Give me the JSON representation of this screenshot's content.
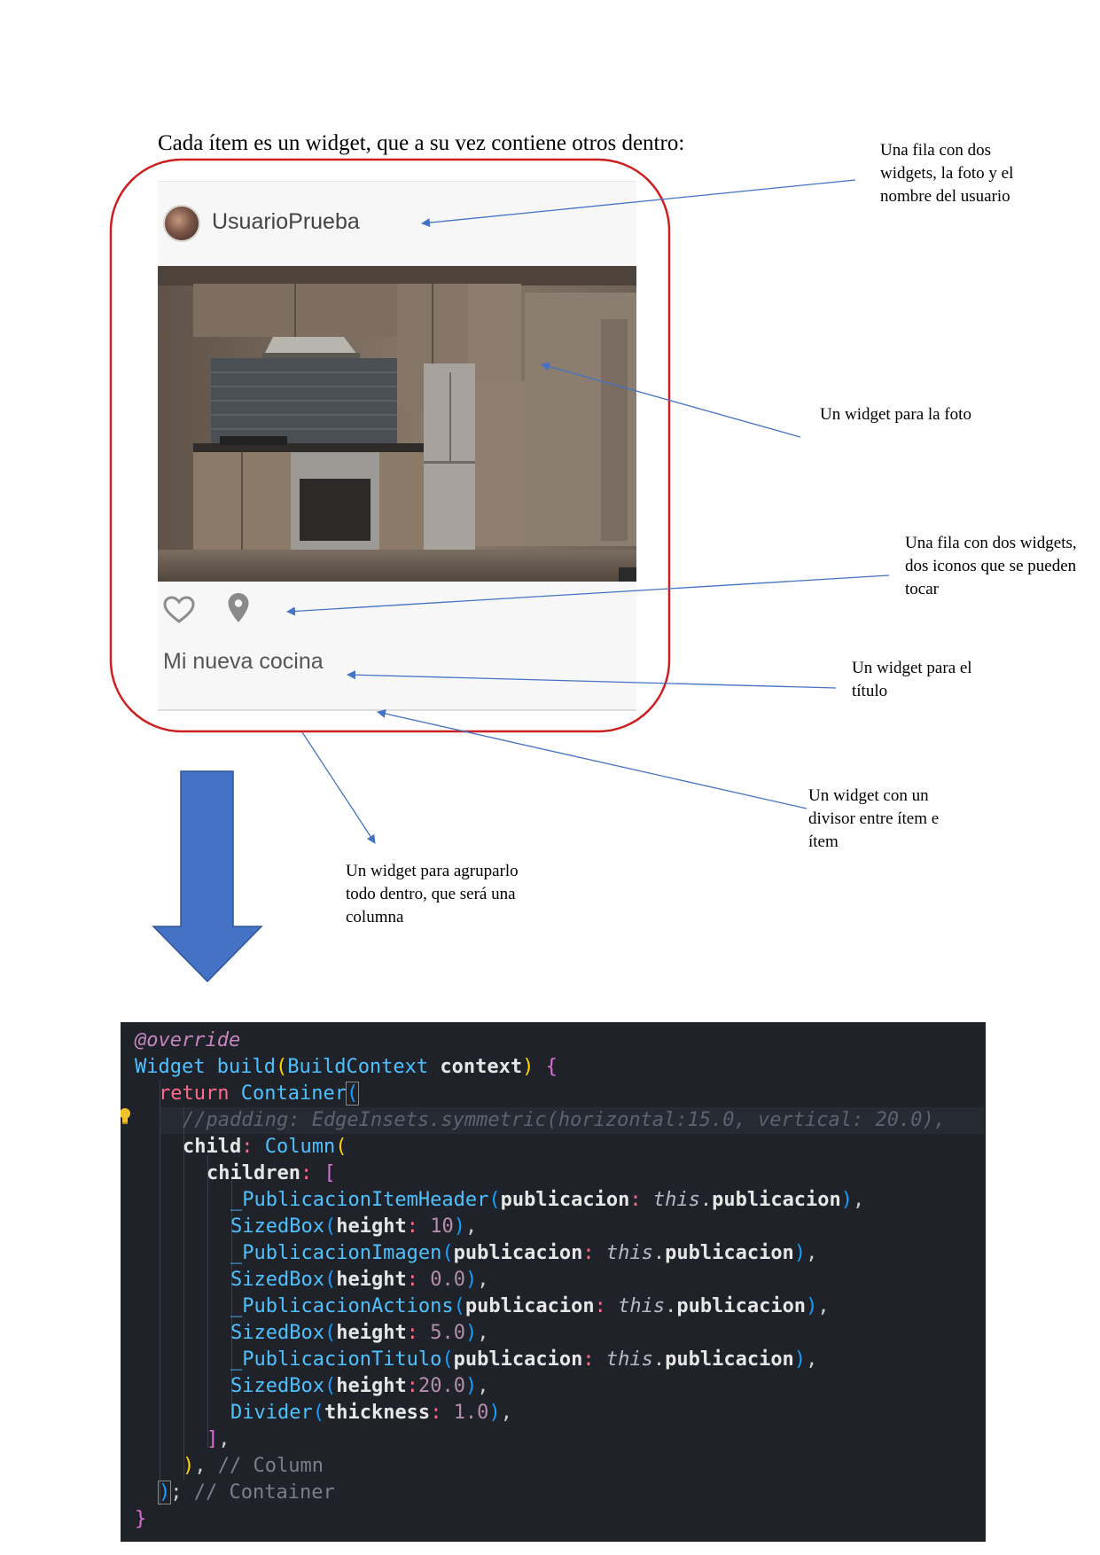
{
  "heading": "Cada ítem es un widget, que a su vez contiene otros dentro:",
  "card": {
    "username": "UsuarioPrueba",
    "title": "Mi nueva cocina",
    "icons": [
      "avatar-photo",
      "heart-outline-icon",
      "location-pin-icon"
    ]
  },
  "notes": {
    "header_row": "Una fila con dos widgets, la foto y el nombre del usuario",
    "photo": "Un widget para la foto",
    "actions_row": "Una fila con dos widgets, dos iconos que se pueden tocar",
    "title": "Un widget para el título",
    "divider": "Un widget con un divisor entre ítem e ítem",
    "column": "Un widget para agruparlo todo dentro, que será una columna"
  },
  "colors": {
    "outline": "#cc1f1f",
    "arrow": "#4472c4",
    "code_bg": "#1f2229"
  },
  "code": {
    "override": "@override",
    "build_return": "Widget",
    "build_name": "build",
    "build_param_type": "BuildContext",
    "build_param_name": "context",
    "return_kw": "return",
    "container": "Container",
    "padding_comment": "//padding: EdgeInsets.symmetric(horizontal:15.0, vertical: 20.0),",
    "child_key": "child",
    "column": "Column",
    "children_key": "children",
    "publicacion_key": "publicacion",
    "this_kw": "this",
    "publicacion_val": "publicacion",
    "header_widget": "_PublicacionItemHeader",
    "image_widget": "_PublicacionImagen",
    "actions_widget": "_PublicacionActions",
    "title_widget": "_PublicacionTitulo",
    "sizedbox": "SizedBox",
    "height_key": "height",
    "h1": "10",
    "h2": "0.0",
    "h3": "5.0",
    "h4": "20.0",
    "divider_widget": "Divider",
    "thickness_key": "thickness",
    "thickness_val": "1.0",
    "column_comment": "// Column",
    "container_comment": "// Container"
  }
}
